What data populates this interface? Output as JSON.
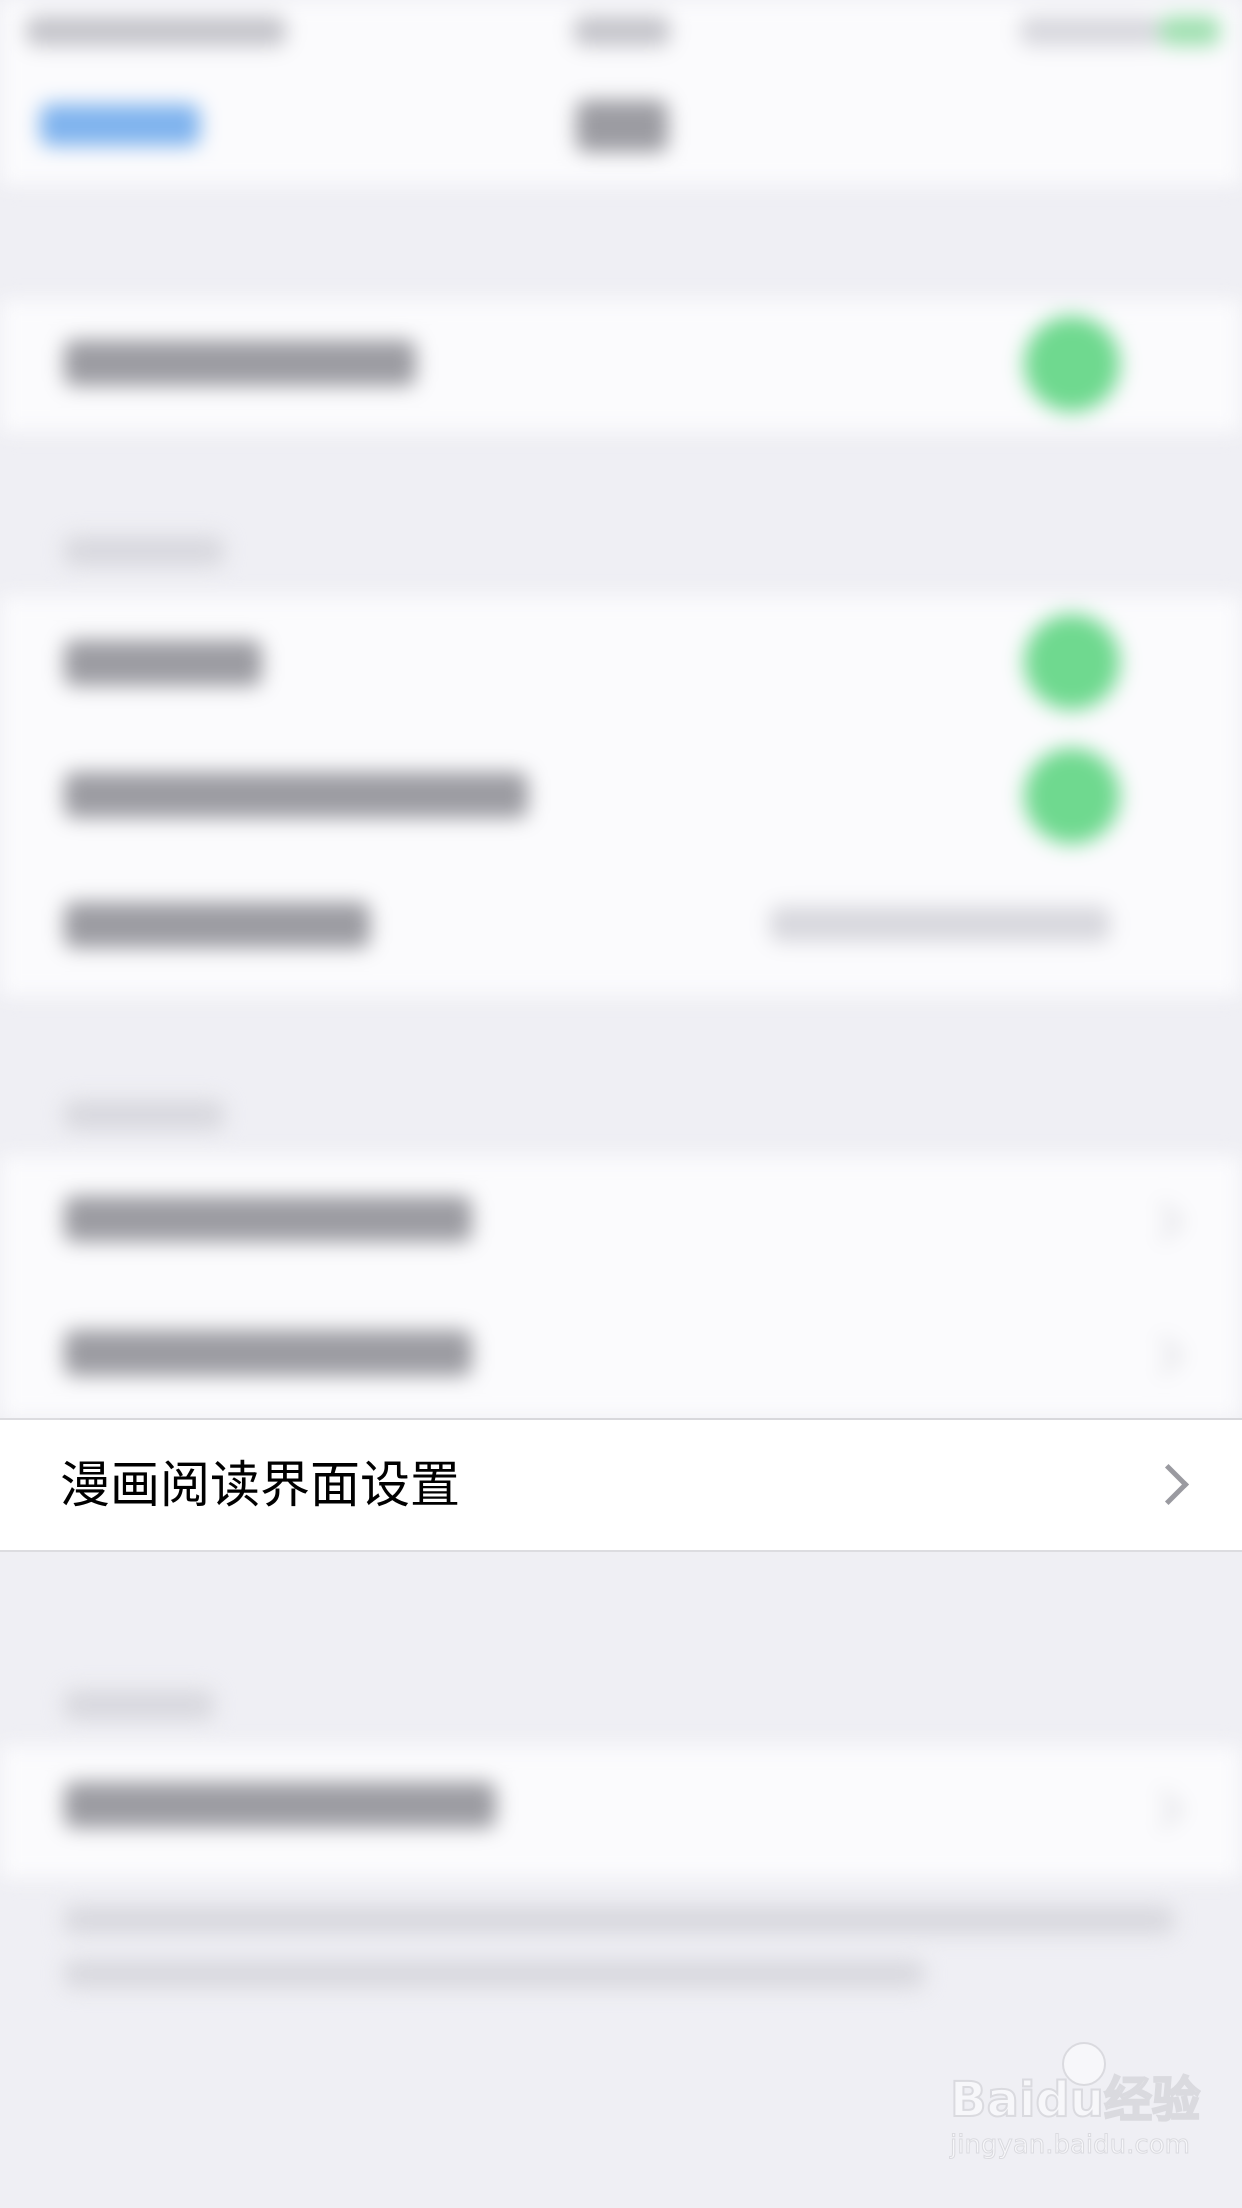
{
  "focused_row": {
    "label": "漫画阅读界面设置"
  },
  "watermark": {
    "brand": "Baidu经验",
    "url": "jingyan.baidu.com"
  },
  "colors": {
    "background": "#efeff4",
    "cell": "#ffffff",
    "switch_on": "#6fd98f",
    "nav_accent": "#7fb3ee",
    "chevron": "#9a9aa0"
  },
  "icons": {
    "chevron": "chevron-right-icon",
    "watermark_logo": "baidu-paw-icon"
  }
}
